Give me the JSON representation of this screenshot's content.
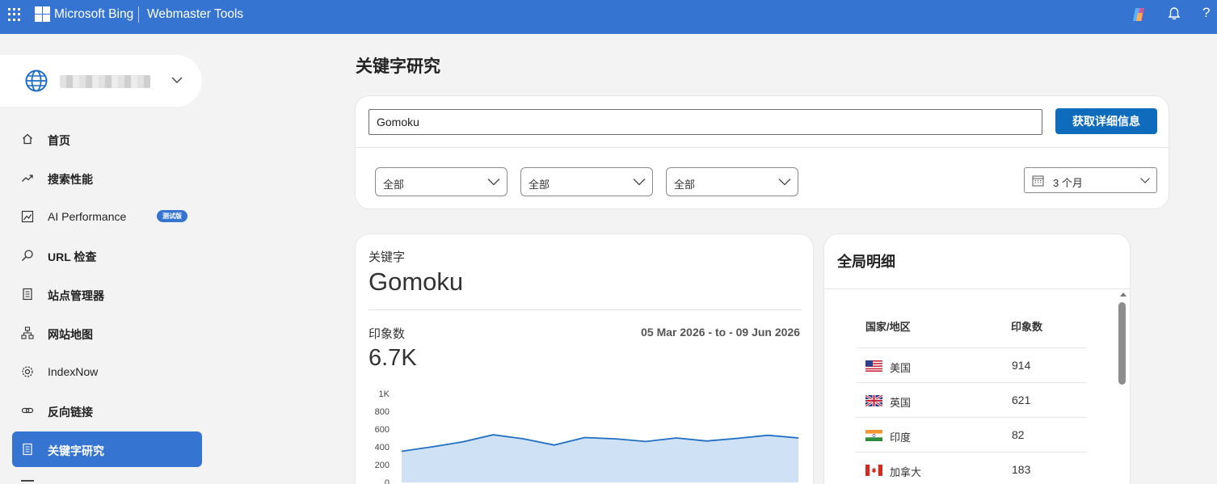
{
  "header": {
    "brand": "Microsoft Bing",
    "product": "Webmaster Tools",
    "help_label": "?"
  },
  "sidebar": {
    "items": [
      {
        "label": "首页",
        "icon": "home-icon"
      },
      {
        "label": "搜索性能",
        "icon": "trend-icon"
      },
      {
        "label": "AI Performance",
        "icon": "ai-chart-icon",
        "badge": "测试版"
      },
      {
        "label": "URL 检查",
        "icon": "search-icon"
      },
      {
        "label": "站点管理器",
        "icon": "document-icon"
      },
      {
        "label": "网站地图",
        "icon": "sitemap-icon"
      },
      {
        "label": "IndexNow",
        "icon": "gear-icon"
      },
      {
        "label": "反向链接",
        "icon": "link-icon"
      },
      {
        "label": "关键字研究",
        "icon": "keyword-doc-icon",
        "active": true
      }
    ]
  },
  "main": {
    "title": "关键字研究",
    "search": {
      "value": "Gomoku",
      "button_label": "获取详细信息"
    },
    "filters": [
      "全部",
      "全部",
      "全部"
    ],
    "date_filter": "3 个月",
    "keyword_card": {
      "keyword_label": "关键字",
      "keyword_value": "Gomoku",
      "impressions_label": "印象数",
      "impressions_value": "6.7K",
      "date_range": "05 Mar 2026 - to - 09 Jun 2026"
    },
    "breakdown": {
      "title": "全局明细",
      "col_country": "国家/地区",
      "col_impressions": "印象数",
      "rows": [
        {
          "country": "美国",
          "value": "914",
          "flag": "us-flag-icon"
        },
        {
          "country": "英国",
          "value": "621",
          "flag": "uk-flag-icon"
        },
        {
          "country": "印度",
          "value": "82",
          "flag": "india-flag-icon"
        },
        {
          "country": "加拿大",
          "value": "183",
          "flag": "canada-flag-icon"
        }
      ]
    }
  },
  "chart_data": {
    "type": "area",
    "y_ticks": [
      "1K",
      "800",
      "600",
      "400",
      "200",
      "0"
    ],
    "ylim": [
      0,
      1000
    ],
    "values": [
      350,
      400,
      455,
      535,
      490,
      420,
      505,
      490,
      460,
      500,
      465,
      495,
      530,
      500
    ],
    "colors": {
      "line": "#1f6fc5",
      "fill": "#cfe1f5"
    }
  }
}
